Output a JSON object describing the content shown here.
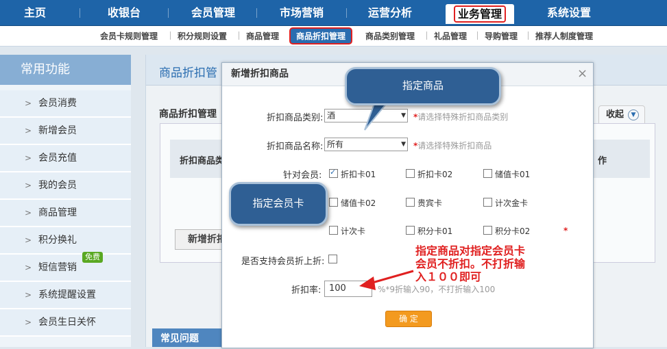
{
  "topnav": {
    "items": [
      "主页",
      "收银台",
      "会员管理",
      "市场营销",
      "运营分析",
      "业务管理",
      "系统设置"
    ],
    "active": "业务管理"
  },
  "subnav": {
    "items": [
      "会员卡规则管理",
      "积分规则设置",
      "商品管理",
      "商品折扣管理",
      "商品类别管理",
      "礼品管理",
      "导购管理",
      "推荐人制度管理"
    ],
    "active": "商品折扣管理"
  },
  "sidebar": {
    "title": "常用功能",
    "items": [
      "会员消费",
      "新增会员",
      "会员充值",
      "我的会员",
      "商品管理",
      "积分换礼",
      "短信营销",
      "系统提醒设置",
      "会员生日关怀"
    ],
    "badge": "免费"
  },
  "main": {
    "title": "商品折扣管",
    "subtitle": "商品折扣管理",
    "collapse": "收起",
    "table_col1": "折扣商品类",
    "table_col_last": "作",
    "add_button": "新增折扣",
    "faq": "常见问题"
  },
  "dialog": {
    "title": "新增折扣商品",
    "close": "×",
    "category_label": "折扣商品类别:",
    "category_value": "酒",
    "category_hint": "请选择特殊折扣商品类别",
    "name_label": "折扣商品名称:",
    "name_value": "所有",
    "name_hint": "请选择特殊折扣商品",
    "member_label": "针对会员:",
    "cards": [
      {
        "label": "折扣卡01",
        "checked": true
      },
      {
        "label": "折扣卡02",
        "checked": false
      },
      {
        "label": "储值卡01",
        "checked": false
      },
      {
        "label": "储值卡02",
        "checked": false
      },
      {
        "label": "贵宾卡",
        "checked": false
      },
      {
        "label": "计次金卡",
        "checked": false
      },
      {
        "label": "计次卡",
        "checked": false
      },
      {
        "label": "积分卡01",
        "checked": false
      },
      {
        "label": "积分卡02",
        "checked": false
      }
    ],
    "required_mark": "*",
    "support_label": "是否支持会员折上折:",
    "rate_label": "折扣率:",
    "rate_value": "100",
    "rate_hint": "%*9折输入90，不打折输入100",
    "ok": "确 定"
  },
  "annotations": {
    "bubble1": "指定商品",
    "bubble2": "指定会员卡",
    "note": "指定商品对指定会员卡\n会员不折扣。不打折输\n入１００即可"
  },
  "colors": {
    "nav_blue": "#1e64a8",
    "highlight_red": "#e02020",
    "ok_orange": "#f39a1f"
  }
}
